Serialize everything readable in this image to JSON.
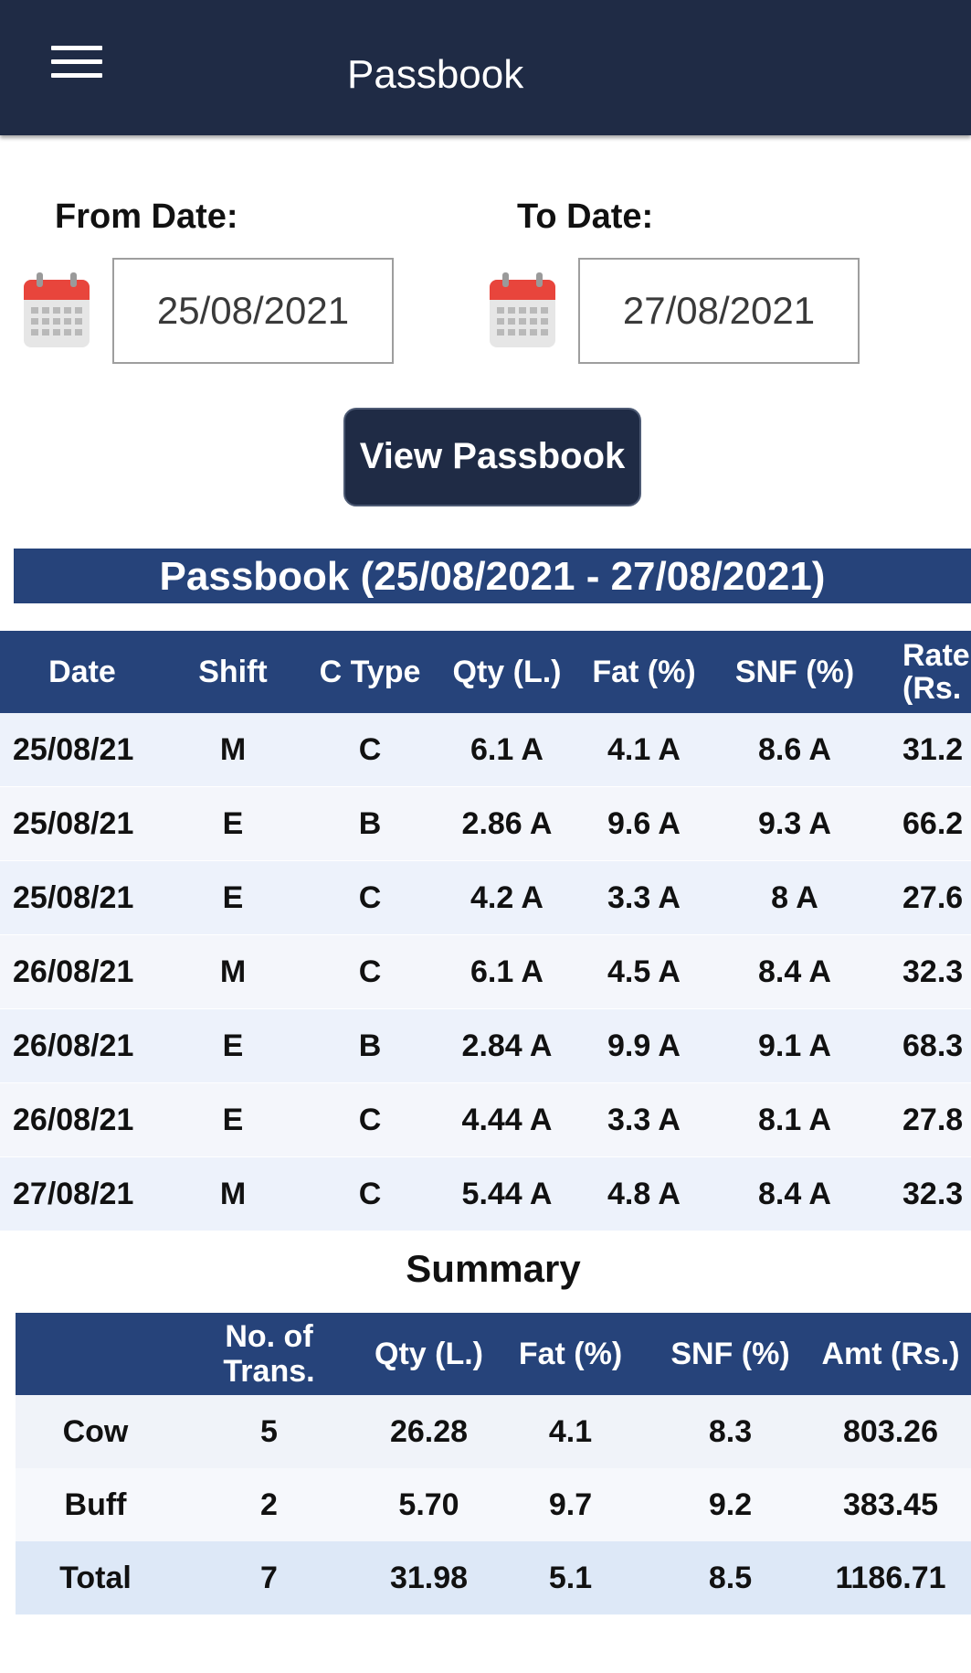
{
  "appbar": {
    "title": "Passbook",
    "menu_icon": "hamburger-menu-icon"
  },
  "filters": {
    "from_label": "From Date:",
    "from_value": "25/08/2021",
    "to_label": "To Date:",
    "to_value": "27/08/2021",
    "calendar_icon": "calendar-icon",
    "view_button": "View Passbook"
  },
  "passbook": {
    "heading": "Passbook (25/08/2021 - 27/08/2021)",
    "columns": [
      "Date",
      "Shift",
      "C Type",
      "Qty (L.)",
      "Fat (%)",
      "SNF (%)",
      "Rate",
      "(Rs."
    ],
    "rows": [
      [
        "25/08/21",
        "M",
        "C",
        "6.1 A",
        "4.1 A",
        "8.6 A",
        "31.2"
      ],
      [
        "25/08/21",
        "E",
        "B",
        "2.86 A",
        "9.6 A",
        "9.3 A",
        "66.2"
      ],
      [
        "25/08/21",
        "E",
        "C",
        "4.2 A",
        "3.3 A",
        "8 A",
        "27.6"
      ],
      [
        "26/08/21",
        "M",
        "C",
        "6.1 A",
        "4.5 A",
        "8.4 A",
        "32.3"
      ],
      [
        "26/08/21",
        "E",
        "B",
        "2.84 A",
        "9.9 A",
        "9.1 A",
        "68.3"
      ],
      [
        "26/08/21",
        "E",
        "C",
        "4.44 A",
        "3.3 A",
        "8.1 A",
        "27.8"
      ],
      [
        "27/08/21",
        "M",
        "C",
        "5.44 A",
        "4.8 A",
        "8.4 A",
        "32.3"
      ]
    ]
  },
  "summary": {
    "title": "Summary",
    "columns": [
      "",
      "No. of",
      "Trans.",
      "Qty (L.)",
      "Fat (%)",
      "SNF (%)",
      "Amt (Rs.)"
    ],
    "rows": [
      [
        "Cow",
        "5",
        "26.28",
        "4.1",
        "8.3",
        "803.26"
      ],
      [
        "Buff",
        "2",
        "5.70",
        "9.7",
        "9.2",
        "383.45"
      ],
      [
        "Total",
        "7",
        "31.98",
        "5.1",
        "8.5",
        "1186.71"
      ]
    ]
  },
  "colors": {
    "appbar": "#1f2b45",
    "table_header": "#26437a",
    "calendar_red": "#e8453c"
  }
}
